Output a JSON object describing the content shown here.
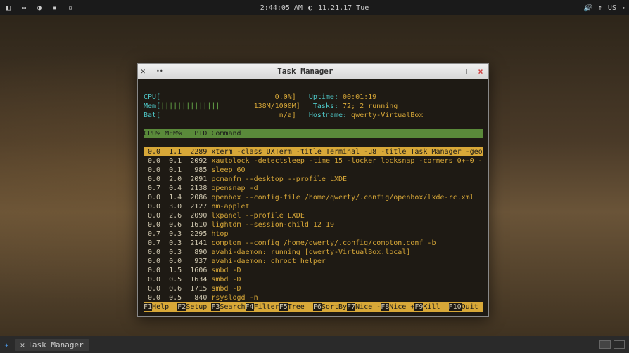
{
  "topbar": {
    "time": "2:44:05 AM",
    "date": "11.21.17 Tue",
    "sound_icon": "🔊",
    "battery_icon": "↑",
    "lang": "US"
  },
  "window": {
    "title": "Task Manager",
    "minimize": "–",
    "maximize": "+",
    "close": "×"
  },
  "htop": {
    "cpu_label": "CPU[",
    "cpu_pct": "0.0%]",
    "mem_label": "Mem[",
    "mem_bars": "||||||||||||||",
    "mem_val": "138M/1000M]",
    "bat_label": "Bat[",
    "bat_val": "n/a]",
    "uptime_label": "Uptime:",
    "uptime_val": "00:01:19",
    "tasks_label": "Tasks:",
    "tasks_val": "72; 2 running",
    "hostname_label": "Hostname:",
    "hostname_val": "qwerty-VirtualBox",
    "headers": {
      "cpu": "CPU%",
      "mem": "MEM%",
      "pid": "PID",
      "cmd": "Command"
    },
    "rows": [
      {
        "cpu": "0.0",
        "mem": "1.1",
        "pid": "2289",
        "cmd": "xterm -class UXTerm -title Terminal -u8 -title Task Manager -geo",
        "sel": true
      },
      {
        "cpu": "0.0",
        "mem": "0.1",
        "pid": "2092",
        "cmd": "xautolock -detectsleep -time 15 -locker locksnap -corners 0+-0 -"
      },
      {
        "cpu": "0.0",
        "mem": "0.1",
        "pid": "985",
        "cmd": "sleep 60"
      },
      {
        "cpu": "0.0",
        "mem": "2.0",
        "pid": "2091",
        "cmd": "pcmanfm --desktop --profile LXDE"
      },
      {
        "cpu": "0.7",
        "mem": "0.4",
        "pid": "2138",
        "cmd": "opensnap -d"
      },
      {
        "cpu": "0.0",
        "mem": "1.4",
        "pid": "2086",
        "cmd": "openbox --config-file /home/qwerty/.config/openbox/lxde-rc.xml"
      },
      {
        "cpu": "0.0",
        "mem": "3.0",
        "pid": "2127",
        "cmd": "nm-applet"
      },
      {
        "cpu": "0.0",
        "mem": "2.6",
        "pid": "2090",
        "cmd": "lxpanel --profile LXDE"
      },
      {
        "cpu": "0.0",
        "mem": "0.6",
        "pid": "1610",
        "cmd": "lightdm --session-child 12 19"
      },
      {
        "cpu": "0.7",
        "mem": "0.3",
        "pid": "2295",
        "cmd": "htop"
      },
      {
        "cpu": "0.7",
        "mem": "0.3",
        "pid": "2141",
        "cmd": "compton --config /home/qwerty/.config/compton.conf -b"
      },
      {
        "cpu": "0.0",
        "mem": "0.3",
        "pid": "890",
        "cmd": "avahi-daemon: running [qwerty-VirtualBox.local]"
      },
      {
        "cpu": "0.0",
        "mem": "0.0",
        "pid": "937",
        "cmd": "avahi-daemon: chroot helper"
      },
      {
        "cpu": "0.0",
        "mem": "1.5",
        "pid": "1606",
        "cmd": "smbd -D"
      },
      {
        "cpu": "0.0",
        "mem": "0.5",
        "pid": "1634",
        "cmd": "smbd -D"
      },
      {
        "cpu": "0.0",
        "mem": "0.6",
        "pid": "1715",
        "cmd": "smbd -D"
      },
      {
        "cpu": "0.0",
        "mem": "0.5",
        "pid": "840",
        "cmd": "rsyslogd -n"
      }
    ],
    "footer": [
      {
        "key": "F1",
        "label": "Help"
      },
      {
        "key": "F2",
        "label": "Setup"
      },
      {
        "key": "F3",
        "label": "Search"
      },
      {
        "key": "F4",
        "label": "Filter"
      },
      {
        "key": "F5",
        "label": "Tree"
      },
      {
        "key": "F6",
        "label": "SortBy"
      },
      {
        "key": "F7",
        "label": "Nice -"
      },
      {
        "key": "F8",
        "label": "Nice +"
      },
      {
        "key": "F9",
        "label": "Kill"
      },
      {
        "key": "F10",
        "label": "Quit"
      }
    ]
  },
  "taskbar": {
    "app": "Task Manager"
  }
}
